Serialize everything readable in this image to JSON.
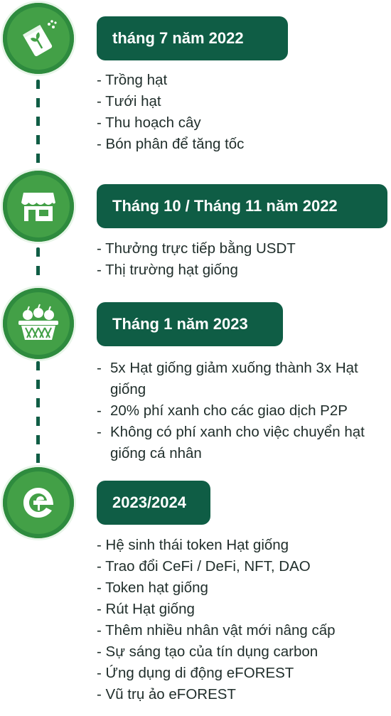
{
  "milestones": [
    {
      "icon": "seed-bag-icon",
      "title": "tháng 7 năm 2022",
      "items": [
        "- Trồng hạt",
        "- Tưới hạt",
        "- Thu hoạch cây",
        "- Bón phân để tăng tốc"
      ]
    },
    {
      "icon": "store-icon",
      "title": "Tháng 10 / Tháng 11 năm 2022",
      "items": [
        "- Thưởng trực tiếp bằng USDT",
        "- Thị trường hạt giống"
      ]
    },
    {
      "icon": "fruit-basket-icon",
      "title": "Tháng 1 năm 2023",
      "dash": "-",
      "items": [
        "5x Hạt giống giảm xuống thành 3x Hạt giống",
        "20% phí xanh cho các giao dịch P2P",
        "Không có phí xanh cho việc chuyển hạt giống cá nhân"
      ]
    },
    {
      "icon": "eforest-logo-icon",
      "title": "2023/2024",
      "items": [
        "- Hệ sinh thái token Hạt giống",
        "- Trao đổi CeFi / DeFi, NFT, DAO",
        "- Token hạt giống",
        "- Rút Hạt giống",
        "- Thêm nhiều nhân vật mới nâng cấp",
        "- Sự sáng tạo của tín dụng carbon",
        "- Ứng dụng di động eFOREST",
        "- Vũ trụ ảo eFOREST"
      ]
    }
  ]
}
